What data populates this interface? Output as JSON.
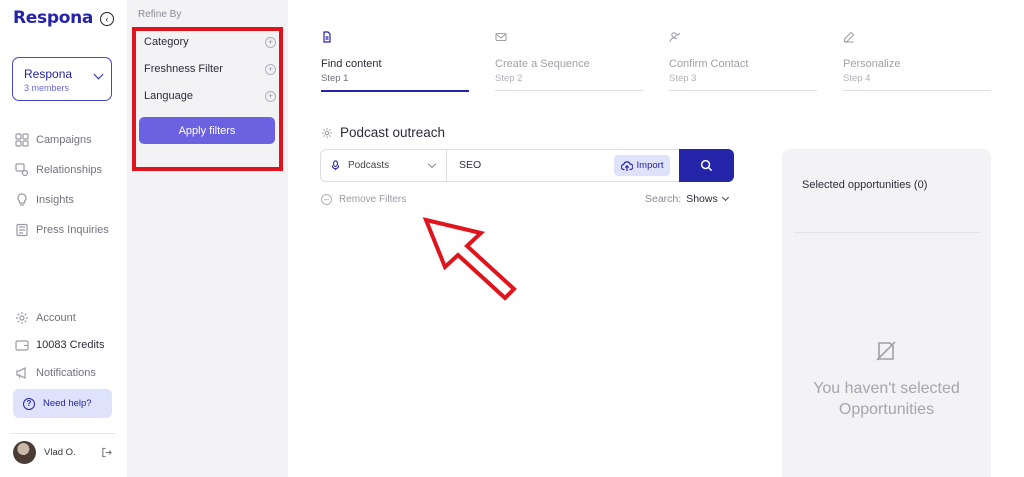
{
  "nav": {
    "logo": "Respona",
    "workspace": {
      "name": "Respona",
      "members": "3 members"
    },
    "items": [
      {
        "label": "Campaigns",
        "icon": "grid-icon"
      },
      {
        "label": "Relationships",
        "icon": "relationships-icon"
      },
      {
        "label": "Insights",
        "icon": "lightbulb-icon"
      },
      {
        "label": "Press Inquiries",
        "icon": "newspaper-icon"
      }
    ],
    "bottom_items": [
      {
        "label": "Account",
        "icon": "gear-icon"
      },
      {
        "label": "10083 Credits",
        "icon": "wallet-icon"
      },
      {
        "label": "Notifications",
        "icon": "megaphone-icon"
      }
    ],
    "help_label": "Need help?",
    "user_name": "Vlad O."
  },
  "refine": {
    "title": "Refine By",
    "filters": [
      "Category",
      "Freshness Filter",
      "Language"
    ],
    "apply_label": "Apply filters"
  },
  "steps": [
    {
      "label": "Find content",
      "sub": "Step 1",
      "active": true
    },
    {
      "label": "Create a Sequence",
      "sub": "Step 2",
      "active": false
    },
    {
      "label": "Confirm Contact",
      "sub": "Step 3",
      "active": false
    },
    {
      "label": "Personalize",
      "sub": "Step 4",
      "active": false
    }
  ],
  "campaign_title": "Podcast outreach",
  "search": {
    "source": "Podcasts",
    "query": "SEO",
    "import_label": "Import"
  },
  "remove_filters_label": "Remove Filters",
  "search_mode": {
    "label": "Search:",
    "value": "Shows"
  },
  "selected": {
    "title": "Selected opportunities (0)",
    "empty_message": "You haven't selected Opportunities"
  },
  "colors": {
    "brand": "#2424a8",
    "apply_button": "#6a62e0",
    "highlight": "#e0141c"
  }
}
